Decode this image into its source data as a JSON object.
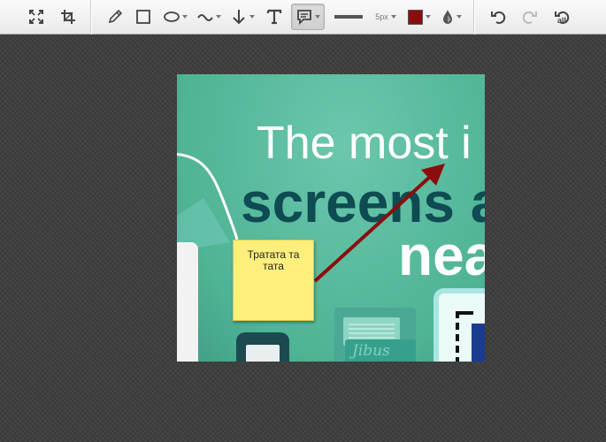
{
  "toolbar": {
    "buttons": [
      {
        "name": "fit-screen",
        "icon": "expand-icon"
      },
      {
        "name": "crop",
        "icon": "crop-icon"
      },
      {
        "name": "pencil",
        "icon": "pencil-icon"
      },
      {
        "name": "rectangle",
        "icon": "rectangle-icon"
      },
      {
        "name": "ellipse",
        "icon": "ellipse-icon"
      },
      {
        "name": "line",
        "icon": "wave-line-icon"
      },
      {
        "name": "arrow",
        "icon": "arrow-down-icon"
      },
      {
        "name": "text",
        "icon": "text-icon"
      },
      {
        "name": "note",
        "icon": "speech-bubble-icon",
        "active": true
      },
      {
        "name": "stroke",
        "icon": "line-thickness-icon"
      },
      {
        "name": "opacity",
        "icon": "drop-icon"
      },
      {
        "name": "undo",
        "icon": "undo-icon"
      },
      {
        "name": "redo",
        "icon": "redo-icon"
      },
      {
        "name": "undo-all",
        "icon": "undo-all-icon"
      }
    ],
    "stroke_size": "5px",
    "color": "#8b0d0d",
    "undo_all_label": "all"
  },
  "canvas": {
    "headline_line1": "The most i",
    "headline_line2": "screens a",
    "headline_line3": "nea",
    "script_text": "Jibus"
  },
  "annotations": {
    "sticky_note_text": "Тратата та тата",
    "arrow_color": "#8b0d0d"
  }
}
